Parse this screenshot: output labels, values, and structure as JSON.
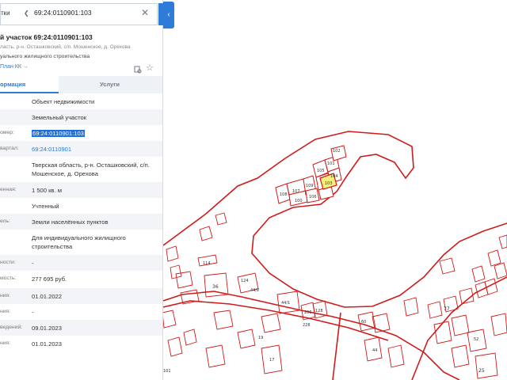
{
  "search": {
    "type_label": "тки",
    "query": "69:24:0110901:103",
    "clear_icon": "close-icon",
    "search_icon": "search-icon"
  },
  "object": {
    "title": "й участок 69:24:0110901:103",
    "address_short": "ласть, р-н. Осташковский, с/п. Мошенское, д. Орехова",
    "purpose_short": "уального жилищного строительства",
    "plan_link": "План КК →"
  },
  "tabs": {
    "info": "ормация",
    "services": "Услуги"
  },
  "rows": [
    {
      "label": "",
      "value": "Объект недвижимости"
    },
    {
      "label": "",
      "value": "Земельный участок"
    },
    {
      "label": "омер:",
      "value": "69:24:0110901:103"
    },
    {
      "label": "вартал:",
      "value": "69:24:0110901"
    },
    {
      "label": "",
      "value": "Тверская область, р-н. Осташковский, с/п. Мошенское, д. Орехова"
    },
    {
      "label": "енная:",
      "value": "1 500 кв. м"
    },
    {
      "label": "",
      "value": "Учтенный"
    },
    {
      "label": "ель:",
      "value": "Земли населённых пунктов"
    },
    {
      "label": "",
      "value": "Для индивидуального жилищного строительства"
    },
    {
      "label": "ности:",
      "value": "-"
    },
    {
      "label": "мость:",
      "value": "277 695 руб."
    },
    {
      "label": "ния:",
      "value": "01.01.2022"
    },
    {
      "label": "ния:",
      "value": "-"
    },
    {
      "label": "ведений:",
      "value": "09.01.2023"
    },
    {
      "label": "ния:",
      "value": "01.01.2023"
    }
  ],
  "map": {
    "highlight_color": "#f5f07a",
    "boundary_color": "#d11a1a",
    "parcel_labels": [
      "102",
      "101",
      "100",
      "109",
      "105",
      "104",
      "103",
      "106",
      "107",
      "108",
      "114",
      "36",
      "124",
      "44/2",
      "44/1",
      "206",
      "128",
      "228",
      "19",
      "17",
      "60",
      "44",
      "25",
      "77",
      "101",
      "52"
    ]
  }
}
